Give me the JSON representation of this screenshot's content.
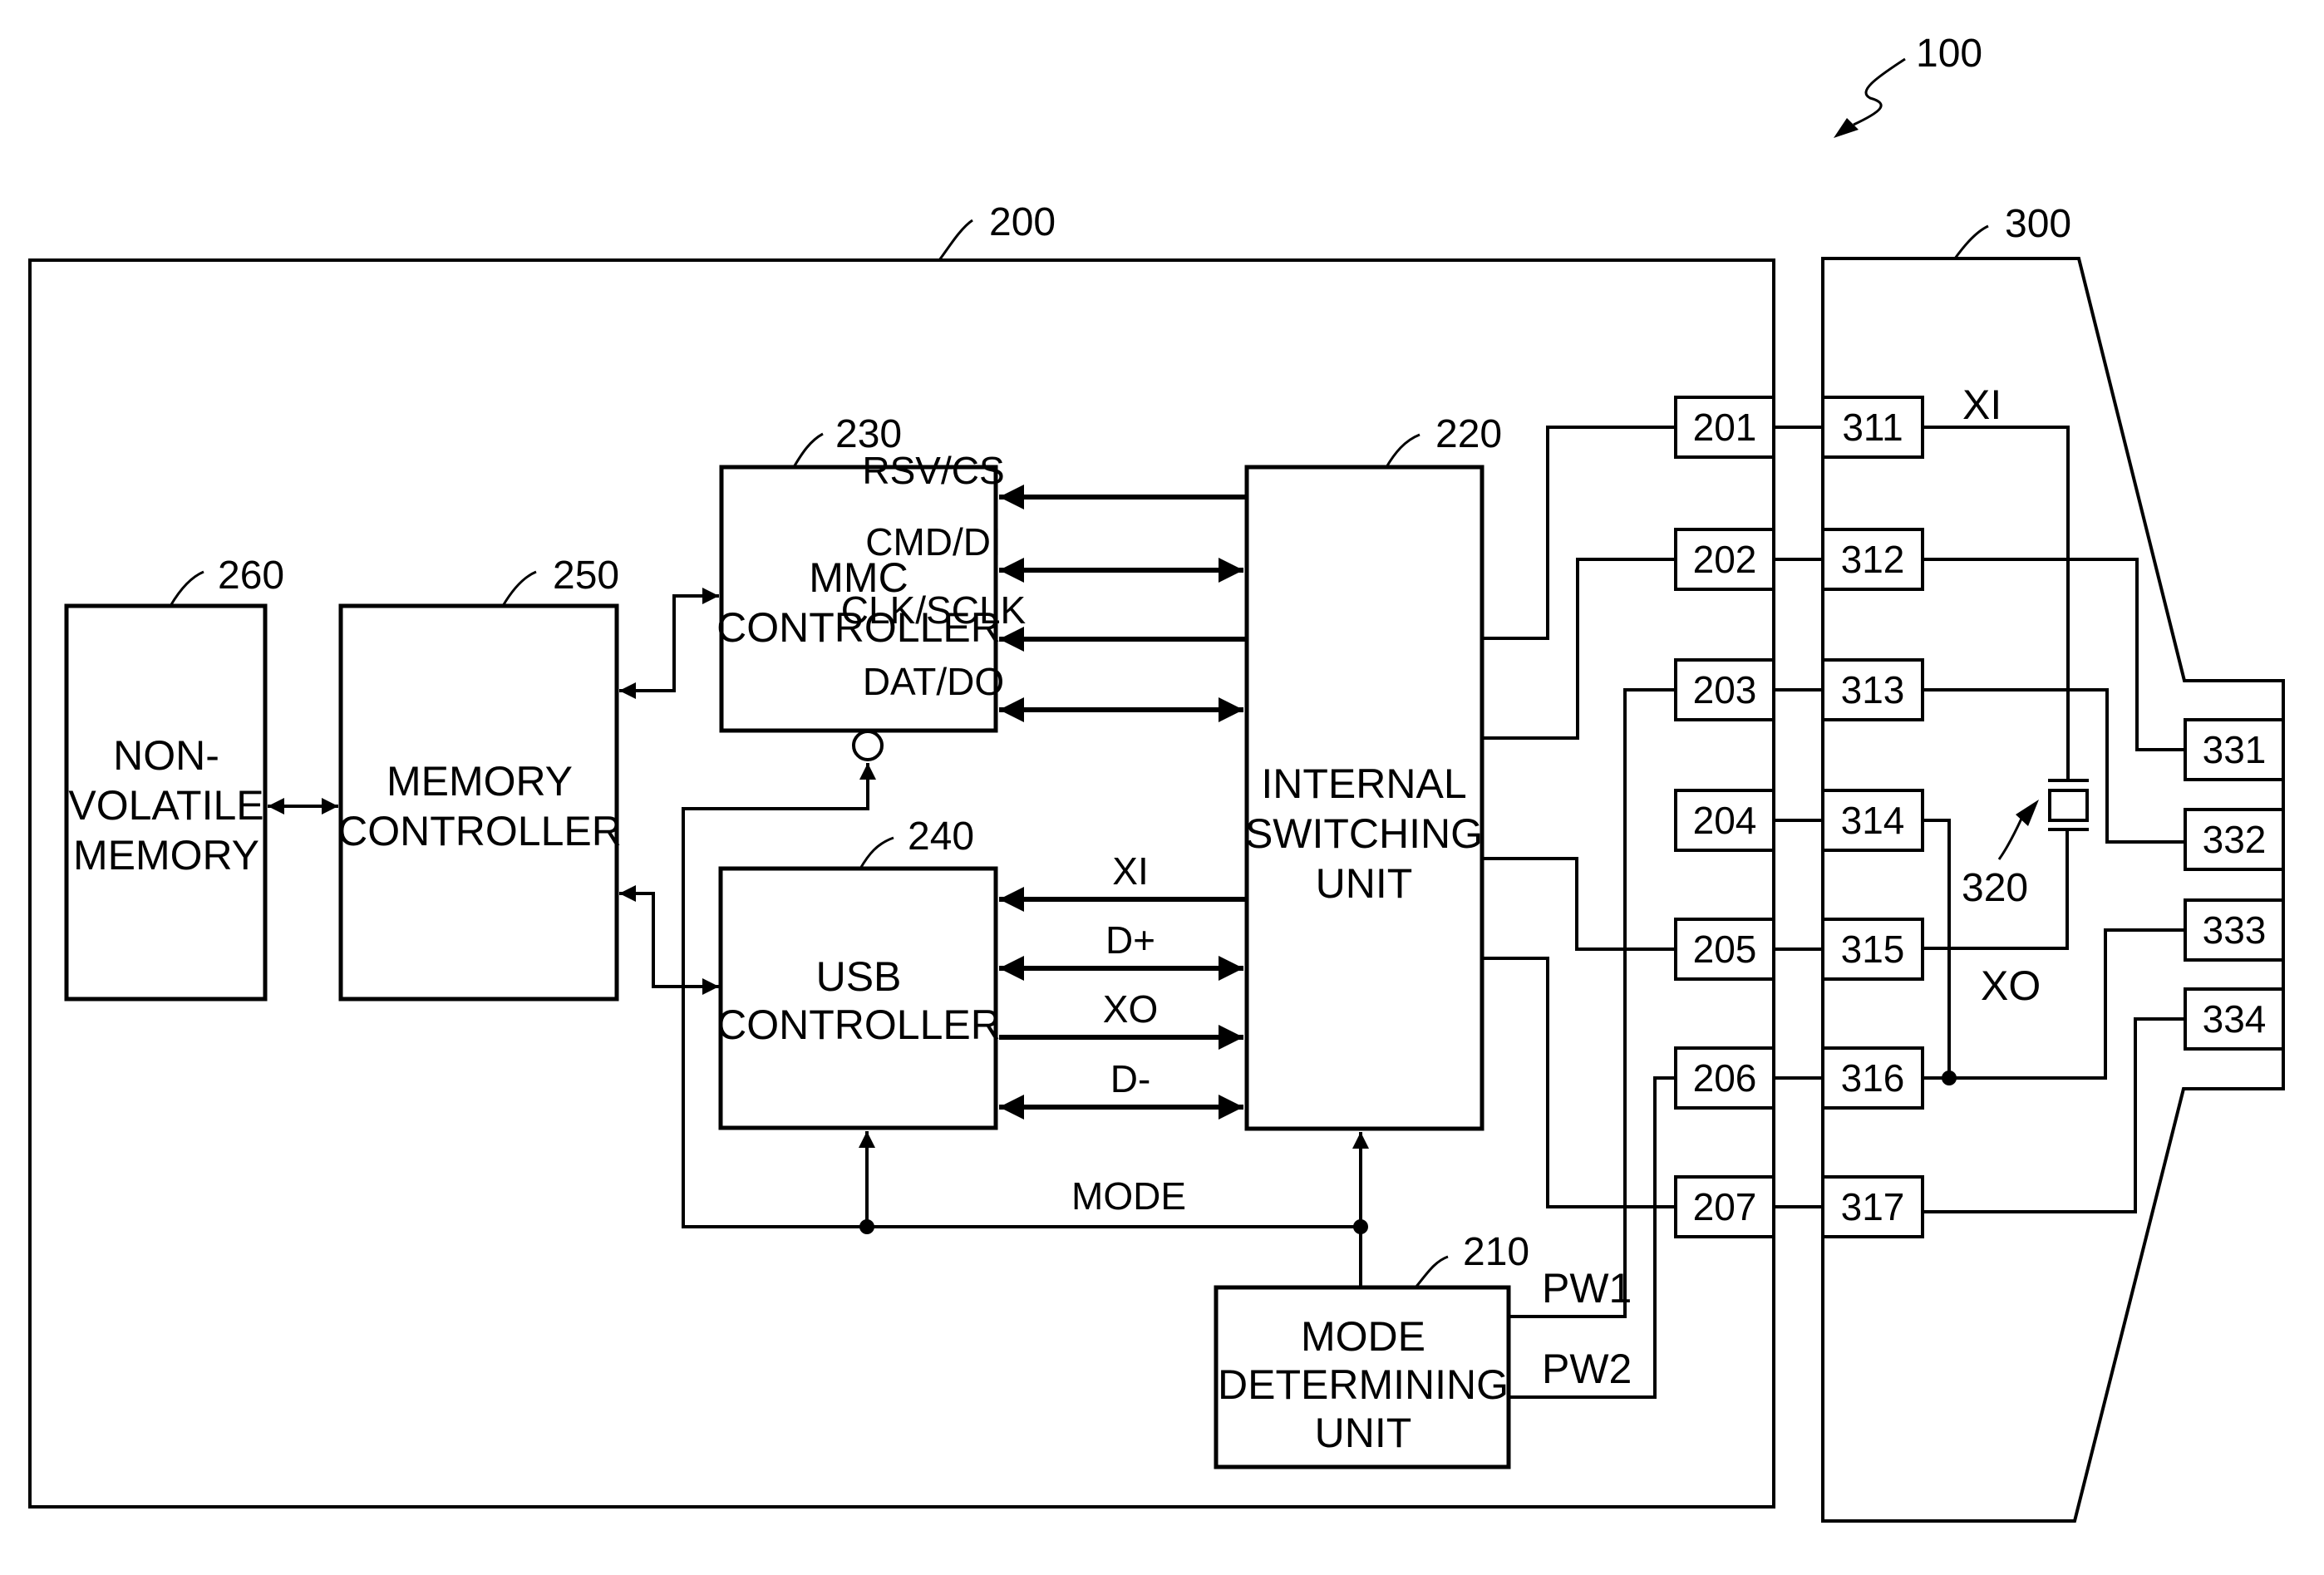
{
  "figure": {
    "system_ref": "100",
    "card_ref": "200",
    "connector_ref": "300",
    "crystal_ref": "320"
  },
  "blocks": {
    "nonvolatile_memory": {
      "ref": "260",
      "lines": [
        "NON-",
        "VOLATILE",
        "MEMORY"
      ]
    },
    "memory_controller": {
      "ref": "250",
      "lines": [
        "MEMORY",
        "CONTROLLER"
      ]
    },
    "mmc_controller": {
      "ref": "230",
      "lines": [
        "MMC",
        "CONTROLLER"
      ]
    },
    "usb_controller": {
      "ref": "240",
      "lines": [
        "USB",
        "CONTROLLER"
      ]
    },
    "internal_switching_unit": {
      "ref": "220",
      "lines": [
        "INTERNAL",
        "SWITCHING",
        "UNIT"
      ]
    },
    "mode_determining_unit": {
      "ref": "210",
      "lines": [
        "MODE",
        "DETERMINING",
        "UNIT"
      ]
    }
  },
  "signals": {
    "mmc": [
      "RSV/CS",
      "CMD/DI",
      "CLK/SCLK",
      "DAT/DO"
    ],
    "usb": [
      "XI",
      "D+",
      "XO",
      "D-"
    ],
    "mode": "MODE",
    "pw1": "PW1",
    "pw2": "PW2",
    "xi": "XI",
    "xo": "XO"
  },
  "pins": {
    "card": [
      "201",
      "202",
      "203",
      "204",
      "205",
      "206",
      "207"
    ],
    "connector_inner": [
      "311",
      "312",
      "313",
      "314",
      "315",
      "316",
      "317"
    ],
    "connector_outer": [
      "331",
      "332",
      "333",
      "334"
    ]
  }
}
